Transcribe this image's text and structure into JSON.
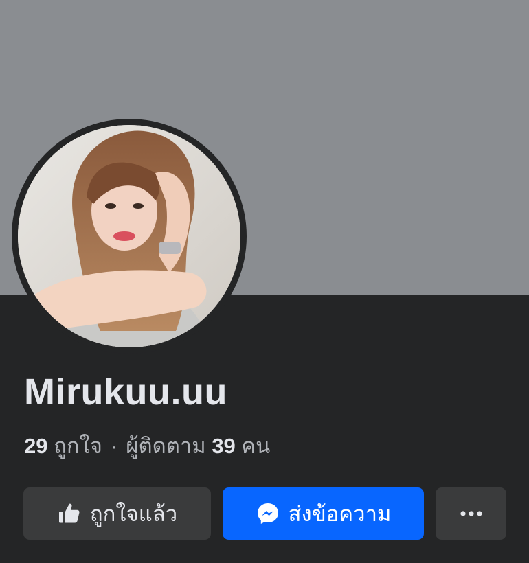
{
  "profile": {
    "name": "Mirukuu.uu",
    "likes_count": "29",
    "likes_label": "ถูกใจ",
    "separator": "·",
    "followers_prefix": "ผู้ติดตาม",
    "followers_count": "39",
    "followers_suffix": "คน"
  },
  "actions": {
    "liked_label": "ถูกใจแล้ว",
    "message_label": "ส่งข้อความ"
  },
  "icons": {
    "liked": "thumbs-up-icon",
    "message": "messenger-icon",
    "more": "more-dots-icon"
  },
  "colors": {
    "background": "#242526",
    "cover": "#8a8d91",
    "button_secondary": "#3a3b3c",
    "button_primary": "#0866ff",
    "text_primary": "#e4e6eb",
    "text_secondary": "#b0b3b8"
  }
}
